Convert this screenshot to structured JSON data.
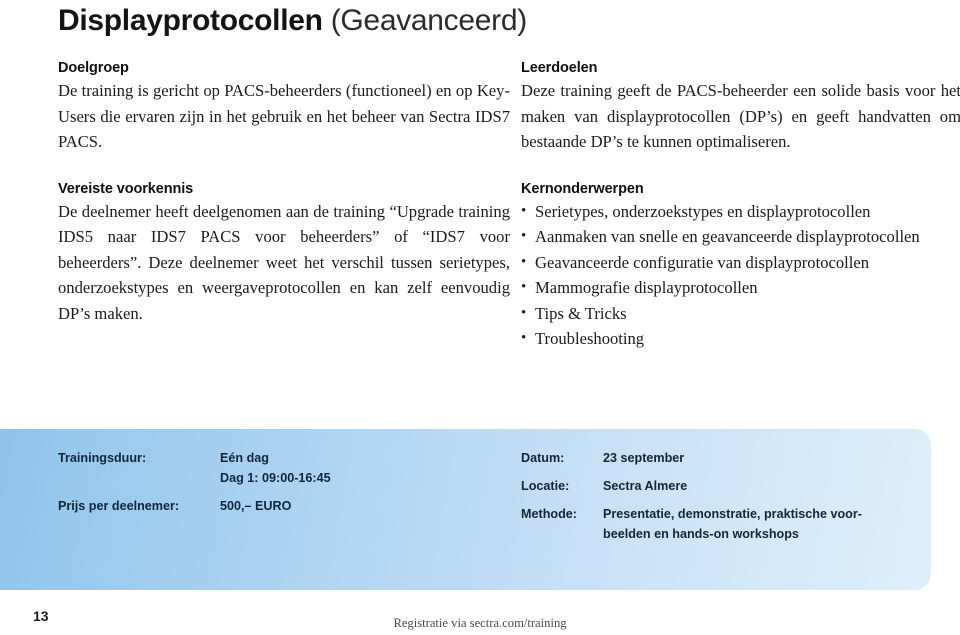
{
  "title": {
    "bold": "Displayprotocollen",
    "light": "(Geavanceerd)"
  },
  "left_column": {
    "sections": [
      {
        "heading": "Doelgroep",
        "body": "De training is gericht op PACS-beheerders (functioneel) en op Key-Users die ervaren zijn in het gebruik en het beheer van Sectra IDS7 PACS."
      },
      {
        "heading": "Vereiste voorkennis",
        "body": "De deelnemer heeft deelgenomen aan de training “Upgrade training IDS5 naar IDS7 PACS voor beheerders” of “IDS7 voor beheerders”. Deze deelnemer weet het verschil tussen serietypes, onderzoekstypes en weergaveprotocollen en kan zelf eenvoudig DP’s maken."
      }
    ]
  },
  "right_column": {
    "learning_goals": {
      "heading": "Leerdoelen",
      "body": "Deze training geeft de PACS-beheerder een solide basis voor het maken van displayprotocollen (DP’s) en geeft handvatten om bestaande DP’s te kunnen optimaliseren."
    },
    "core_topics": {
      "heading": "Kernonderwerpen",
      "items": [
        "Serietypes, onderzoekstypes en displayprotocollen",
        "Aanmaken van snelle en geavanceerde displayprotocollen",
        "Geavanceerde configuratie van displayprotocollen",
        "Mammografie displayprotocollen",
        "Tips & Tricks",
        "Troubleshooting"
      ]
    }
  },
  "info_panel": {
    "left_rows": [
      {
        "label": "Trainingsduur:",
        "value": "Eén dag",
        "value_line2": "Dag 1: 09:00-16:45"
      },
      {
        "label": "Prijs per deelnemer:",
        "value": "500,– EURO",
        "value_line2": ""
      }
    ],
    "right_rows": [
      {
        "label": "Datum:",
        "value": "23 september",
        "value_line2": ""
      },
      {
        "label": "Locatie:",
        "value": "Sectra Almere",
        "value_line2": ""
      },
      {
        "label": "Methode:",
        "value": "Presentatie, demonstratie, praktische voor-",
        "value_line2": "beelden en hands-on workshops"
      }
    ],
    "colors": {
      "gradient_start": "#8fc3ea",
      "gradient_end": "#dfeffb",
      "text": "#12263a"
    }
  },
  "footer": {
    "page_number": "13",
    "note": "Registratie via sectra.com/training"
  }
}
